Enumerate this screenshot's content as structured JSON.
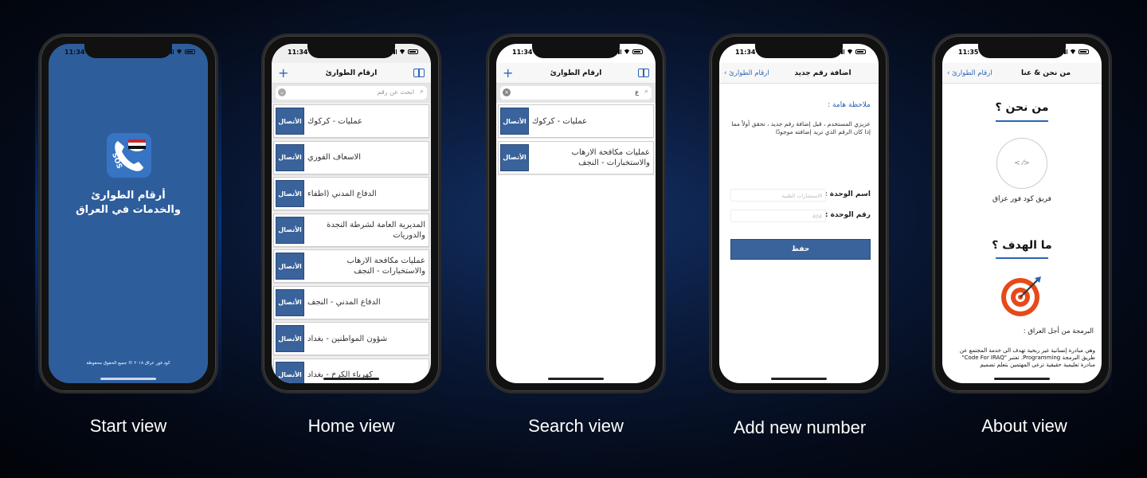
{
  "colors": {
    "accent": "#2b64b8",
    "brand_blue": "#2e5d9c",
    "call_button": "#3a639b"
  },
  "captions": {
    "start": "Start view",
    "home": "Home view",
    "search": "Search view",
    "add": "Add new number",
    "about": "About view"
  },
  "start": {
    "time": "11:34",
    "app_title_line1": "أرقام الطوارئ",
    "app_title_line2": "والخدمات في العراق",
    "sos": "SOS",
    "footer": "كود فور عراق ٢٠١٨ © جميع الحقوق محفوظة"
  },
  "home": {
    "time": "11:34",
    "title": "ارقام الطوارئ",
    "search_placeholder": "ابحث عن رقم",
    "call_label": "الأتصال",
    "items": [
      {
        "label": "عمليات - كركوك"
      },
      {
        "label": "الاسعاف الفوري"
      },
      {
        "label": "الدفاع المدني (اطفاء"
      },
      {
        "label": "المديرية العامة لشرطة النجدة والدوريات"
      },
      {
        "label": "عمليات مكافحة الارهاب والاستخبارات - النجف"
      },
      {
        "label": "الدفاع المدني - النجف"
      },
      {
        "label": "شؤون المواطنين - بغداد"
      },
      {
        "label": "كهرباء الكرخ - بغداد"
      }
    ]
  },
  "search": {
    "time": "11:34",
    "title": "ارقام الطوارئ",
    "query": "ع",
    "call_label": "الأتصال",
    "items": [
      {
        "label": "عمليات - كركوك"
      },
      {
        "label": "عمليات مكافحة الارهاب والاستخبارات - النجف"
      }
    ]
  },
  "add": {
    "time": "11:34",
    "back": "ارقام الطوارئ",
    "title": "اضافة رقم جديد",
    "note_title": "ملاحظة هامة :",
    "note_text": "عزيزي المستخدم ، قبل إضافة رقم جديد ، تحقق أولاً مما إذا كان الرقم الذي تريد إضافته موجودًا",
    "unit_name_label": "اسم الوحدة :",
    "unit_name_placeholder": "الاستشارات الطبية",
    "unit_number_label": "رقم الوحدة :",
    "unit_number_placeholder": "404",
    "save": "حفظ"
  },
  "about": {
    "time": "11:35",
    "back": "ارقام الطوارئ",
    "title": "من نحن & عنا",
    "who_heading": "من نحن ؟",
    "team_name": "فريق كود فور عراق",
    "goal_heading": "ما الهدف ؟",
    "goal_sub": "البرمجة من أجل العراق :",
    "goal_text": "وهي مبادرة إنسانية غير ربحية تهدف الى خدمة المجتمع عن طريق البرمجة Programming. تعتبر \"Code For IRAQ\" مبادرة تعليمية حقيقية ترعى المهتمين بتعلم تصميم"
  }
}
